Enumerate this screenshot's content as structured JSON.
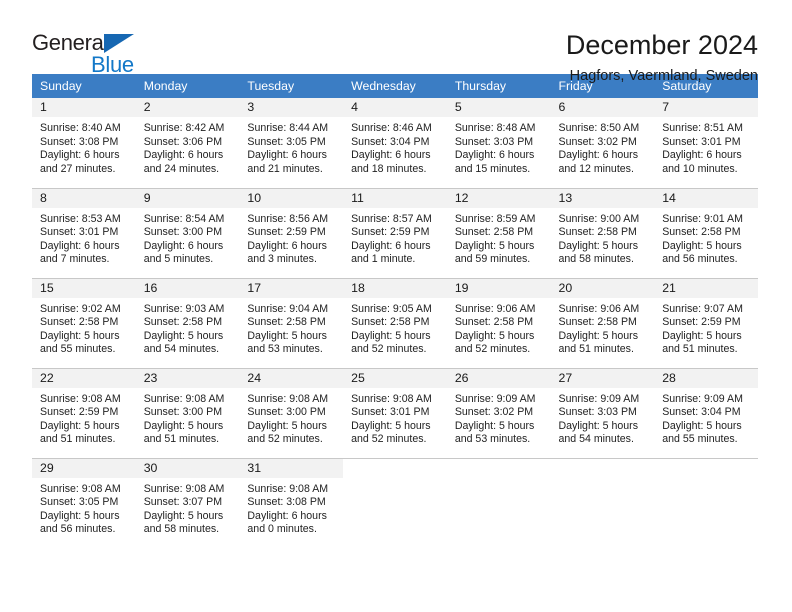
{
  "logo": {
    "word1": "General",
    "word2": "Blue",
    "triangle_color": "#1667b2",
    "blue_color": "#1378c8"
  },
  "header": {
    "title": "December 2024",
    "subtitle": "Hagfors, Vaermland, Sweden"
  },
  "theme": {
    "header_row_bg": "#3b7dc4",
    "daynum_bg": "#f2f2f2",
    "grid_line": "#c8c8c8"
  },
  "calendar": {
    "weekday_headers": [
      "Sunday",
      "Monday",
      "Tuesday",
      "Wednesday",
      "Thursday",
      "Friday",
      "Saturday"
    ],
    "weeks": [
      [
        {
          "day": "1",
          "sunrise": "Sunrise: 8:40 AM",
          "sunset": "Sunset: 3:08 PM",
          "daylight1": "Daylight: 6 hours",
          "daylight2": "and 27 minutes."
        },
        {
          "day": "2",
          "sunrise": "Sunrise: 8:42 AM",
          "sunset": "Sunset: 3:06 PM",
          "daylight1": "Daylight: 6 hours",
          "daylight2": "and 24 minutes."
        },
        {
          "day": "3",
          "sunrise": "Sunrise: 8:44 AM",
          "sunset": "Sunset: 3:05 PM",
          "daylight1": "Daylight: 6 hours",
          "daylight2": "and 21 minutes."
        },
        {
          "day": "4",
          "sunrise": "Sunrise: 8:46 AM",
          "sunset": "Sunset: 3:04 PM",
          "daylight1": "Daylight: 6 hours",
          "daylight2": "and 18 minutes."
        },
        {
          "day": "5",
          "sunrise": "Sunrise: 8:48 AM",
          "sunset": "Sunset: 3:03 PM",
          "daylight1": "Daylight: 6 hours",
          "daylight2": "and 15 minutes."
        },
        {
          "day": "6",
          "sunrise": "Sunrise: 8:50 AM",
          "sunset": "Sunset: 3:02 PM",
          "daylight1": "Daylight: 6 hours",
          "daylight2": "and 12 minutes."
        },
        {
          "day": "7",
          "sunrise": "Sunrise: 8:51 AM",
          "sunset": "Sunset: 3:01 PM",
          "daylight1": "Daylight: 6 hours",
          "daylight2": "and 10 minutes."
        }
      ],
      [
        {
          "day": "8",
          "sunrise": "Sunrise: 8:53 AM",
          "sunset": "Sunset: 3:01 PM",
          "daylight1": "Daylight: 6 hours",
          "daylight2": "and 7 minutes."
        },
        {
          "day": "9",
          "sunrise": "Sunrise: 8:54 AM",
          "sunset": "Sunset: 3:00 PM",
          "daylight1": "Daylight: 6 hours",
          "daylight2": "and 5 minutes."
        },
        {
          "day": "10",
          "sunrise": "Sunrise: 8:56 AM",
          "sunset": "Sunset: 2:59 PM",
          "daylight1": "Daylight: 6 hours",
          "daylight2": "and 3 minutes."
        },
        {
          "day": "11",
          "sunrise": "Sunrise: 8:57 AM",
          "sunset": "Sunset: 2:59 PM",
          "daylight1": "Daylight: 6 hours",
          "daylight2": "and 1 minute."
        },
        {
          "day": "12",
          "sunrise": "Sunrise: 8:59 AM",
          "sunset": "Sunset: 2:58 PM",
          "daylight1": "Daylight: 5 hours",
          "daylight2": "and 59 minutes."
        },
        {
          "day": "13",
          "sunrise": "Sunrise: 9:00 AM",
          "sunset": "Sunset: 2:58 PM",
          "daylight1": "Daylight: 5 hours",
          "daylight2": "and 58 minutes."
        },
        {
          "day": "14",
          "sunrise": "Sunrise: 9:01 AM",
          "sunset": "Sunset: 2:58 PM",
          "daylight1": "Daylight: 5 hours",
          "daylight2": "and 56 minutes."
        }
      ],
      [
        {
          "day": "15",
          "sunrise": "Sunrise: 9:02 AM",
          "sunset": "Sunset: 2:58 PM",
          "daylight1": "Daylight: 5 hours",
          "daylight2": "and 55 minutes."
        },
        {
          "day": "16",
          "sunrise": "Sunrise: 9:03 AM",
          "sunset": "Sunset: 2:58 PM",
          "daylight1": "Daylight: 5 hours",
          "daylight2": "and 54 minutes."
        },
        {
          "day": "17",
          "sunrise": "Sunrise: 9:04 AM",
          "sunset": "Sunset: 2:58 PM",
          "daylight1": "Daylight: 5 hours",
          "daylight2": "and 53 minutes."
        },
        {
          "day": "18",
          "sunrise": "Sunrise: 9:05 AM",
          "sunset": "Sunset: 2:58 PM",
          "daylight1": "Daylight: 5 hours",
          "daylight2": "and 52 minutes."
        },
        {
          "day": "19",
          "sunrise": "Sunrise: 9:06 AM",
          "sunset": "Sunset: 2:58 PM",
          "daylight1": "Daylight: 5 hours",
          "daylight2": "and 52 minutes."
        },
        {
          "day": "20",
          "sunrise": "Sunrise: 9:06 AM",
          "sunset": "Sunset: 2:58 PM",
          "daylight1": "Daylight: 5 hours",
          "daylight2": "and 51 minutes."
        },
        {
          "day": "21",
          "sunrise": "Sunrise: 9:07 AM",
          "sunset": "Sunset: 2:59 PM",
          "daylight1": "Daylight: 5 hours",
          "daylight2": "and 51 minutes."
        }
      ],
      [
        {
          "day": "22",
          "sunrise": "Sunrise: 9:08 AM",
          "sunset": "Sunset: 2:59 PM",
          "daylight1": "Daylight: 5 hours",
          "daylight2": "and 51 minutes."
        },
        {
          "day": "23",
          "sunrise": "Sunrise: 9:08 AM",
          "sunset": "Sunset: 3:00 PM",
          "daylight1": "Daylight: 5 hours",
          "daylight2": "and 51 minutes."
        },
        {
          "day": "24",
          "sunrise": "Sunrise: 9:08 AM",
          "sunset": "Sunset: 3:00 PM",
          "daylight1": "Daylight: 5 hours",
          "daylight2": "and 52 minutes."
        },
        {
          "day": "25",
          "sunrise": "Sunrise: 9:08 AM",
          "sunset": "Sunset: 3:01 PM",
          "daylight1": "Daylight: 5 hours",
          "daylight2": "and 52 minutes."
        },
        {
          "day": "26",
          "sunrise": "Sunrise: 9:09 AM",
          "sunset": "Sunset: 3:02 PM",
          "daylight1": "Daylight: 5 hours",
          "daylight2": "and 53 minutes."
        },
        {
          "day": "27",
          "sunrise": "Sunrise: 9:09 AM",
          "sunset": "Sunset: 3:03 PM",
          "daylight1": "Daylight: 5 hours",
          "daylight2": "and 54 minutes."
        },
        {
          "day": "28",
          "sunrise": "Sunrise: 9:09 AM",
          "sunset": "Sunset: 3:04 PM",
          "daylight1": "Daylight: 5 hours",
          "daylight2": "and 55 minutes."
        }
      ],
      [
        {
          "day": "29",
          "sunrise": "Sunrise: 9:08 AM",
          "sunset": "Sunset: 3:05 PM",
          "daylight1": "Daylight: 5 hours",
          "daylight2": "and 56 minutes."
        },
        {
          "day": "30",
          "sunrise": "Sunrise: 9:08 AM",
          "sunset": "Sunset: 3:07 PM",
          "daylight1": "Daylight: 5 hours",
          "daylight2": "and 58 minutes."
        },
        {
          "day": "31",
          "sunrise": "Sunrise: 9:08 AM",
          "sunset": "Sunset: 3:08 PM",
          "daylight1": "Daylight: 6 hours",
          "daylight2": "and 0 minutes."
        },
        {
          "day": "",
          "sunrise": "",
          "sunset": "",
          "daylight1": "",
          "daylight2": ""
        },
        {
          "day": "",
          "sunrise": "",
          "sunset": "",
          "daylight1": "",
          "daylight2": ""
        },
        {
          "day": "",
          "sunrise": "",
          "sunset": "",
          "daylight1": "",
          "daylight2": ""
        },
        {
          "day": "",
          "sunrise": "",
          "sunset": "",
          "daylight1": "",
          "daylight2": ""
        }
      ]
    ]
  }
}
